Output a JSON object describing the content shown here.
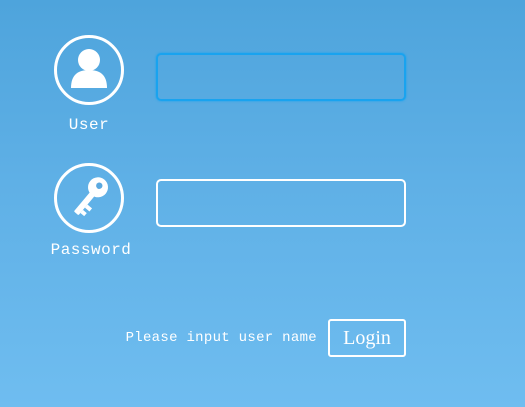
{
  "user_field": {
    "icon": "user-icon",
    "label": "User",
    "value": "",
    "state": "focused"
  },
  "password_field": {
    "icon": "key-icon",
    "label": "Password",
    "value": ""
  },
  "status_message": "Please input user name",
  "login_button": "Login",
  "colors": {
    "background_top": "#4ea4dc",
    "background_bottom": "#6fbdf0",
    "focus_border": "#19a3ef",
    "foreground": "#ffffff"
  }
}
